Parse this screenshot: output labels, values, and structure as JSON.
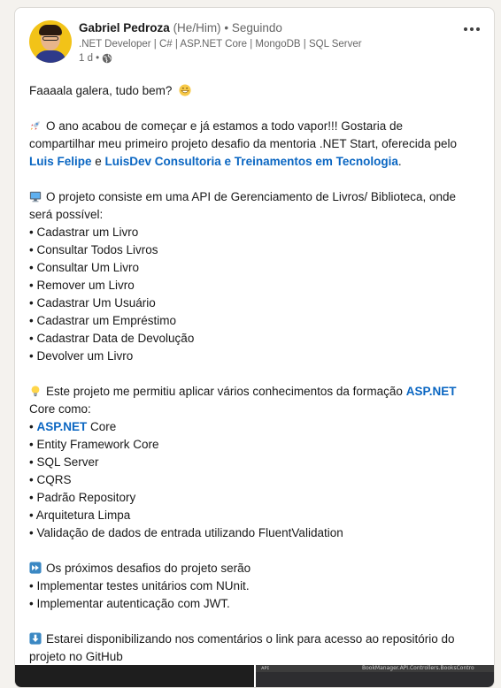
{
  "author": {
    "name": "Gabriel Pedroza",
    "pronouns": "(He/Him)",
    "separator": "•",
    "follow_status": "Seguindo",
    "headline": ".NET Developer | C# | ASP.NET Core | MongoDB | SQL Server",
    "time": "1 d •"
  },
  "post": {
    "greeting": "Faaaala galera, tudo bem?",
    "p1_l1": "O ano acabou de começar e já estamos a todo vapor!!! Gostaria de",
    "p1_l2": "compartilhar meu primeiro projeto desafio da mentoria .NET Start, oferecida pelo",
    "mention_1": "Luis Felipe",
    "mention_join": " e ",
    "mention_2": "LuisDev Consultoria e Treinamentos em Tecnologia",
    "mention_end": ".",
    "p2_l1": "O projeto consiste em uma API de Gerenciamento de Livros/ Biblioteca, onde",
    "p2_l2": "será possível:",
    "features": [
      "• Cadastrar um Livro",
      "• Consultar Todos Livros",
      "• Consultar Um Livro",
      "• Remover um Livro",
      "• Cadastrar Um Usuário",
      "• Cadastrar um Empréstimo",
      "• Cadastrar Data de Devolução",
      "• Devolver um Livro"
    ],
    "p3_l1": "Este projeto me permitiu aplicar vários conhecimentos da formação",
    "p3_link": "ASP.NET",
    "p3_l2": "Core como:",
    "tech_first_bullet": "• ",
    "tech_first_link": "ASP.NET",
    "tech_first_rest": " Core",
    "techs": [
      "• Entity Framework Core",
      "• SQL Server",
      "• CQRS",
      "• Padrão Repository",
      "• Arquitetura Limpa",
      "• Validação de dados de entrada utilizando FluentValidation"
    ],
    "p4_title": "Os próximos desafios do projeto serão",
    "next": [
      "• Implementar testes unitários com NUnit.",
      "• Implementar autenticação com JWT."
    ],
    "p5_l1": "Estarei disponibilizando nos comentários o link para acesso ao repositório do",
    "p5_l2": "projeto no GitHub"
  },
  "images": {
    "thumb_b_left": "ᴀᴘɪ",
    "thumb_b_right": "BookManager.API.Controllers.BooksContro"
  },
  "colors": {
    "link": "#0a66c2",
    "card_bg": "#ffffff",
    "page_bg": "#f4f2ee"
  },
  "icons": [
    "globe-icon",
    "more-options-icon",
    "grin-emoji-icon",
    "rocket-emoji-icon",
    "computer-emoji-icon",
    "lightbulb-emoji-icon",
    "fast-forward-emoji-icon",
    "down-arrow-emoji-icon"
  ]
}
